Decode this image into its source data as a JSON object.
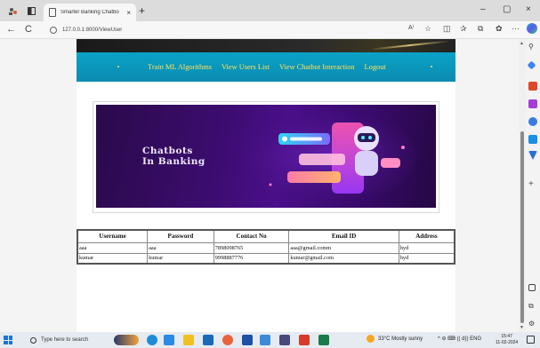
{
  "browser": {
    "tab_title": "Smarter Banking Chatbo",
    "tab_close": "×",
    "new_tab": "+",
    "minimize": "–",
    "maximize": "▢",
    "close": "×",
    "back": "←",
    "refresh": "C",
    "url": "127.0.0.1:8000/ViewUser",
    "more": "···"
  },
  "nav": {
    "items": [
      {
        "label": "Train ML Algorithms"
      },
      {
        "label": "View Users List"
      },
      {
        "label": "View Chatbot Interaction"
      },
      {
        "label": "Logout"
      }
    ]
  },
  "hero": {
    "title": "Chatbots\nIn Banking"
  },
  "users_table": {
    "headers": [
      "Username",
      "Password",
      "Contact No",
      "Email ID",
      "Address"
    ],
    "rows": [
      [
        "aaa",
        "aaa",
        "7898098765",
        "aaa@gmail.comm",
        "hyd"
      ],
      [
        "kumar",
        "kumar",
        "9998887776",
        "kumar@gmail.com",
        "hyd"
      ]
    ]
  },
  "taskbar": {
    "search_placeholder": "Type here to search",
    "weather": "33°C  Mostly sunny",
    "tray": "^  ⊖  ⌨  ((  d))  ENG",
    "time": "15:47",
    "date": "11-02-2024"
  },
  "colors": {
    "navbar": "#0b9cc2",
    "nav_link": "#ffe45c",
    "hero_bg": "#3b0c6e"
  }
}
